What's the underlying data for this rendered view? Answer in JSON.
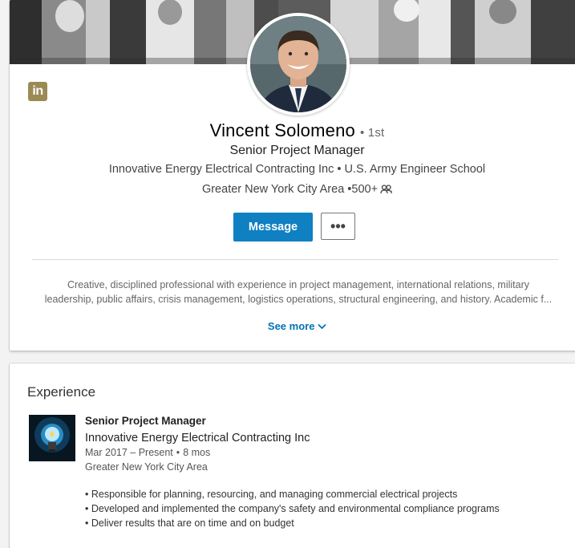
{
  "profile": {
    "name": "Vincent Solomeno",
    "degree": "• 1st",
    "headline": "Senior Project Manager",
    "company_line": "Innovative Energy Electrical Contracting Inc • U.S. Army Engineer School",
    "location": "Greater New York City Area",
    "connections": "•500+",
    "message_label": "Message",
    "more_label": "•••",
    "summary_line1": "Creative, disciplined professional with experience in project management, international relations, military",
    "summary_line2": "leadership, public affairs, crisis management, logistics operations, structural engineering, and history. Academic f...",
    "see_more_label": "See more"
  },
  "brand": {
    "logo_text": "in",
    "logo_color": "#9c8a55",
    "accent": "#0f80c1",
    "link": "#0073b1"
  },
  "experience": {
    "heading": "Experience",
    "items": [
      {
        "title": "Senior Project Manager",
        "company": "Innovative Energy Electrical Contracting Inc",
        "dates": "Mar 2017 – Present",
        "duration": "8 mos",
        "location": "Greater New York City Area",
        "bullets": [
          "• Responsible for planning, resourcing, and managing commercial electrical projects",
          "• Developed and implemented the company's safety and environmental compliance programs",
          "• Deliver results that are on time and on budget"
        ]
      }
    ]
  }
}
